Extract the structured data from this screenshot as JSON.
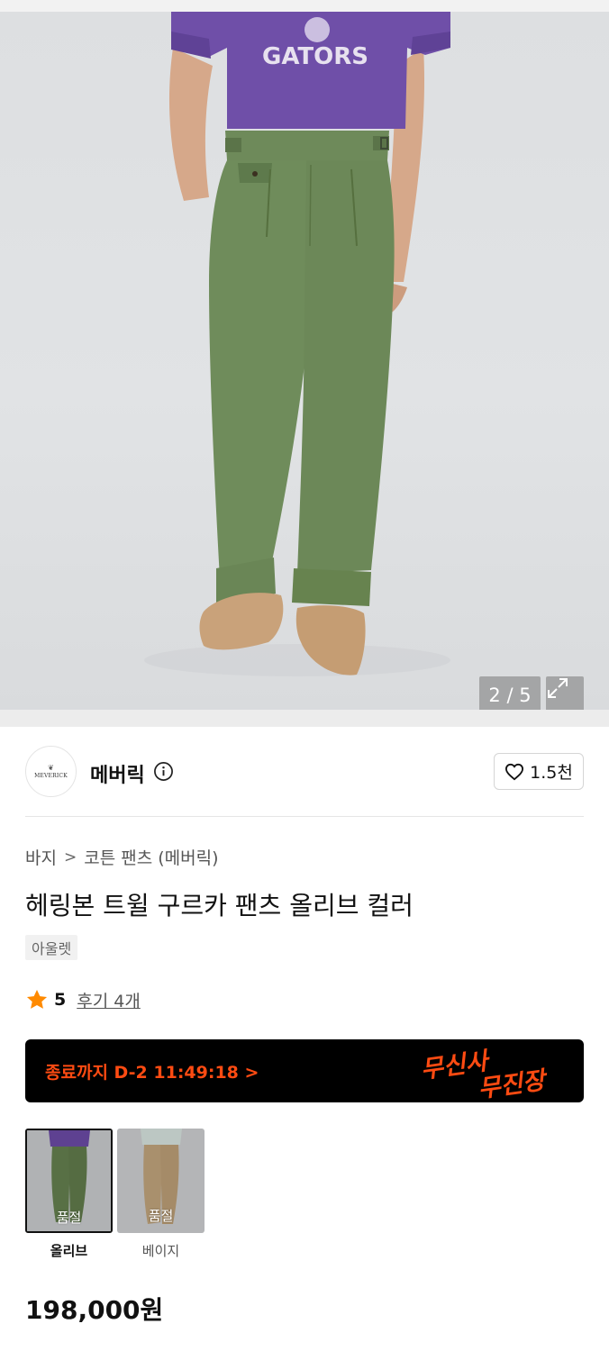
{
  "gallery": {
    "counter": "2 / 5",
    "shirt_print": "GATORS"
  },
  "brand": {
    "logo_text": "MEVERICK",
    "name": "메버릭",
    "likes": "1.5천"
  },
  "breadcrumb": {
    "category": "바지",
    "separator": ">",
    "subcategory": "코튼 팬츠 (메버릭)"
  },
  "product": {
    "title": "헤링본 트윌 구르카 팬츠 올리브 컬러",
    "tag": "아울렛",
    "rating": "5",
    "review_link": "후기 4개",
    "price": "198,000원"
  },
  "promo": {
    "countdown": "종료까지 D-2 11:49:18 >",
    "logo_line1": "무신사",
    "logo_line2": "무진장",
    "color": "#ff4b12"
  },
  "colors": [
    {
      "label": "올리브",
      "status": "품절",
      "selected": true
    },
    {
      "label": "베이지",
      "status": "품절",
      "selected": false
    }
  ]
}
